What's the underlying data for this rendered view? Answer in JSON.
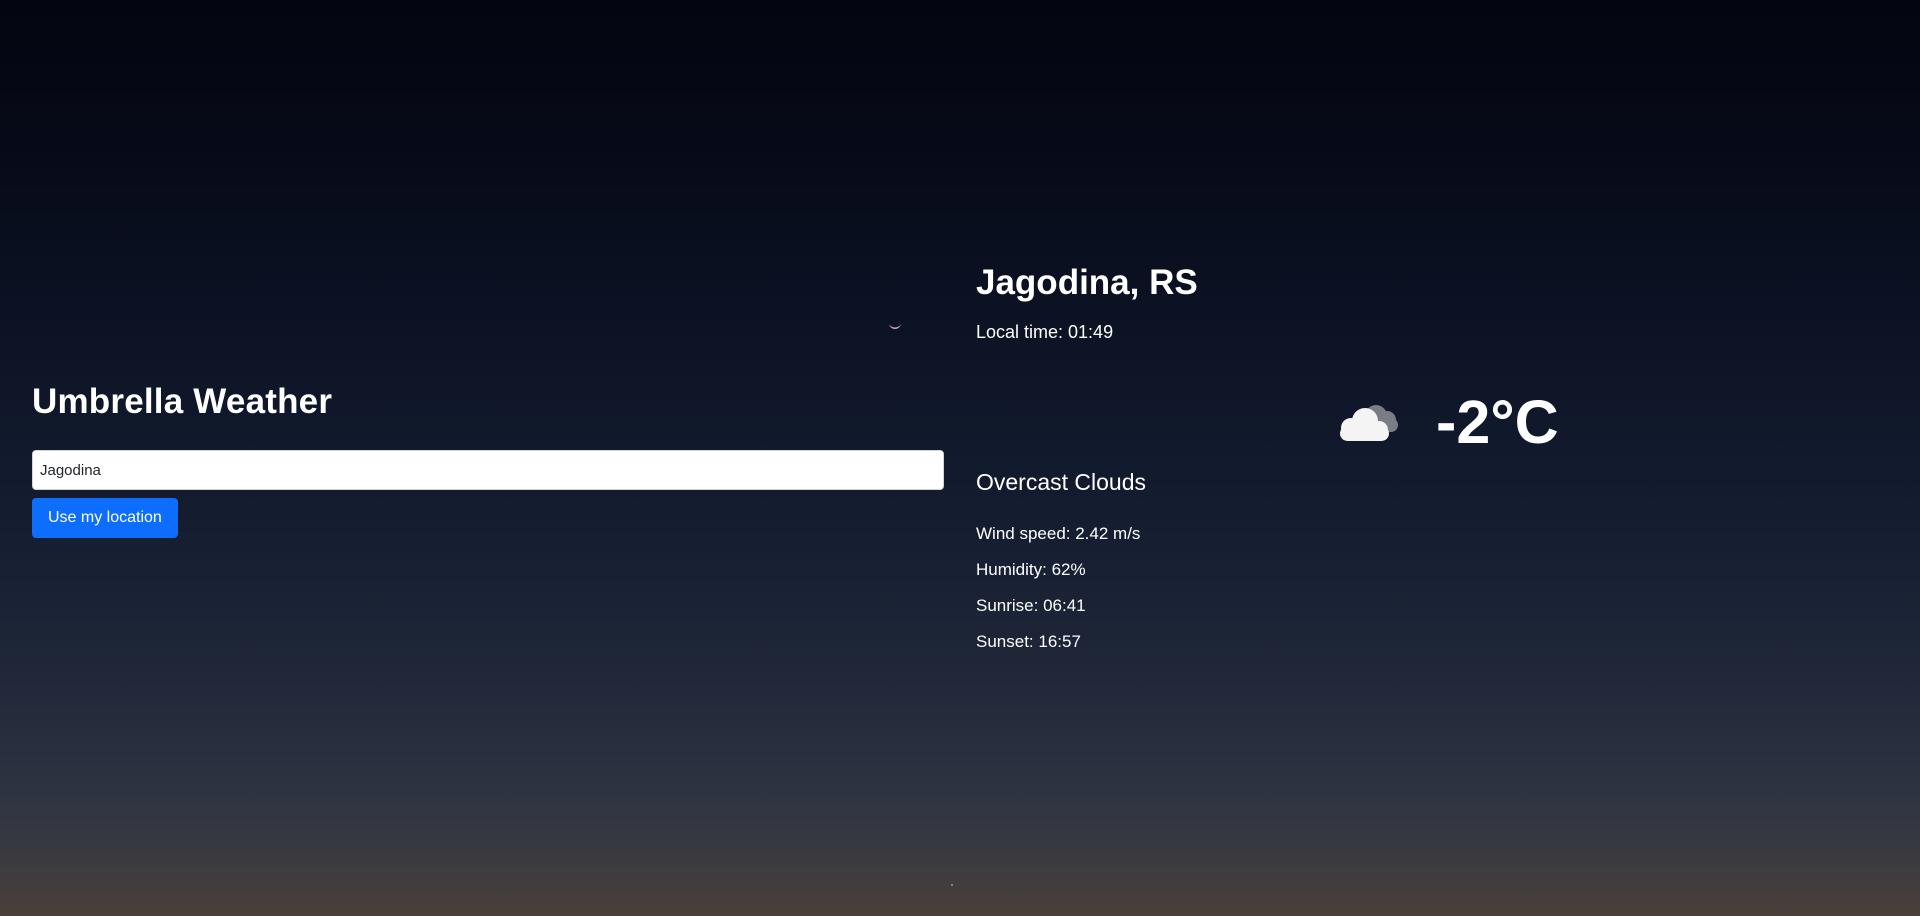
{
  "app": {
    "title": "Umbrella Weather"
  },
  "search": {
    "value": "Jagodina",
    "placeholder": ""
  },
  "location_button": {
    "label": "Use my location"
  },
  "weather": {
    "city": "Jagodina, RS",
    "local_time": "Local time: 01:49",
    "icon": "overcast-clouds-icon",
    "temperature": "-2°C",
    "description": "Overcast Clouds",
    "details": {
      "wind": "Wind speed: 2.42 m/s",
      "humidity": "Humidity: 62%",
      "sunrise": "Sunrise: 06:41",
      "sunset": "Sunset: 16:57"
    }
  },
  "colors": {
    "accent": "#0d6efd",
    "text": "#ffffff",
    "background_top": "#03050f",
    "background_bottom": "#4a3f3a"
  }
}
